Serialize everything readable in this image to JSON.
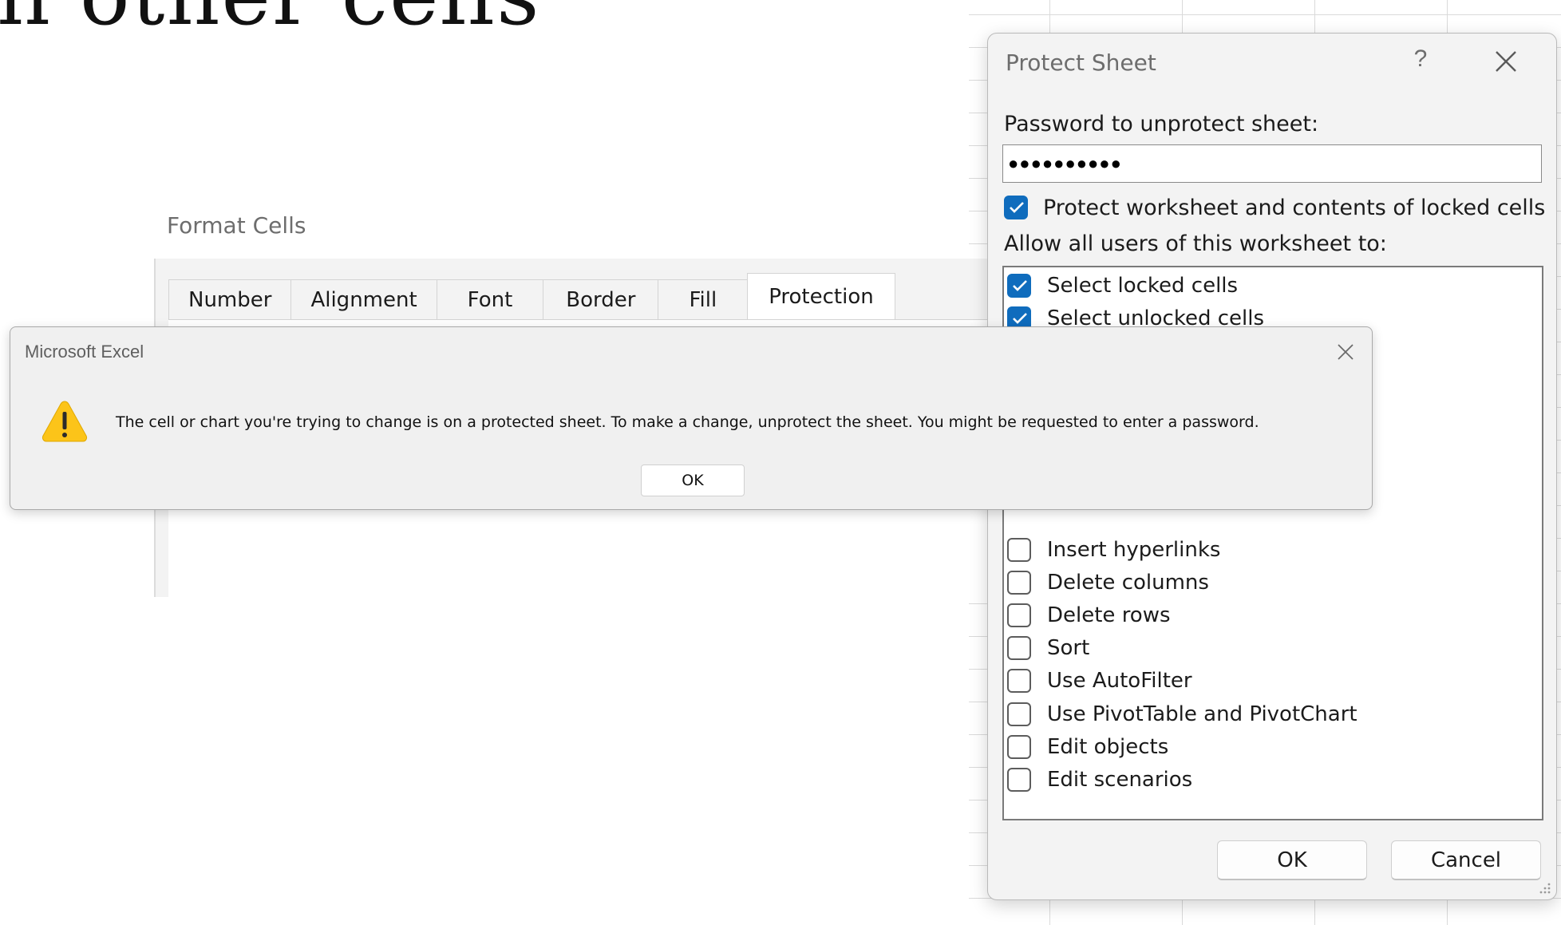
{
  "background": {
    "heading_fragment": "n other cells"
  },
  "format_cells": {
    "title": "Format Cells",
    "tabs": [
      {
        "label": "Number"
      },
      {
        "label": "Alignment"
      },
      {
        "label": "Font"
      },
      {
        "label": "Border"
      },
      {
        "label": "Fill"
      },
      {
        "label": "Protection"
      }
    ],
    "active_tab": "Protection"
  },
  "protect_sheet": {
    "title": "Protect Sheet",
    "help_glyph": "?",
    "password_label": "Password to unprotect sheet:",
    "password_value": "●●●●●●●●●●",
    "protect_contents_label": "Protect worksheet and contents of locked cells",
    "protect_contents_checked": true,
    "allow_label": "Allow all users of this worksheet to:",
    "permissions": [
      {
        "label": "Select locked cells",
        "checked": true
      },
      {
        "label": "Select unlocked cells",
        "checked": true
      },
      {
        "label": "Insert hyperlinks",
        "checked": false
      },
      {
        "label": "Delete columns",
        "checked": false
      },
      {
        "label": "Delete rows",
        "checked": false
      },
      {
        "label": "Sort",
        "checked": false
      },
      {
        "label": "Use AutoFilter",
        "checked": false
      },
      {
        "label": "Use PivotTable and PivotChart",
        "checked": false
      },
      {
        "label": "Edit objects",
        "checked": false
      },
      {
        "label": "Edit scenarios",
        "checked": false
      }
    ],
    "ok_label": "OK",
    "cancel_label": "Cancel",
    "accent_color": "#0f6cbd"
  },
  "alert": {
    "title": "Microsoft Excel",
    "icon": "warning-icon",
    "message": "The cell or chart you're trying to change is on a protected sheet. To make a change, unprotect the sheet. You might be requested to enter a password.",
    "ok_label": "OK"
  }
}
